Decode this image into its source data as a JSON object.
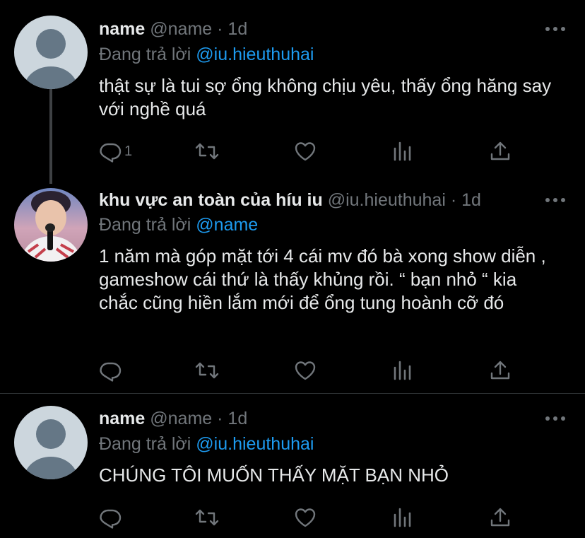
{
  "colors": {
    "background": "#000000",
    "text_primary": "#e7e9ea",
    "text_secondary": "#71767b",
    "link": "#1d9bf0",
    "divider": "#2f3336"
  },
  "tweets": [
    {
      "display_name": "name",
      "handle": "@name",
      "separator": "·",
      "time": "1d",
      "replying_prefix": "Đang trả lời",
      "replying_to": "@iu.hieuthuhai",
      "text": "thật sự là tui sợ ổng không chịu yêu, thấy ổng hăng say với nghề quá",
      "reply_count": "1",
      "avatar": "default-avatar"
    },
    {
      "display_name": "khu vực an toàn của híu iu",
      "handle": "@iu.hieuthuhai",
      "separator": "·",
      "time": "1d",
      "replying_prefix": "Đang trả lời",
      "replying_to": "@name",
      "text": "1 năm mà góp mặt tới 4 cái mv đó bà xong show diễn , gameshow cái thứ là thấy khủng rồi. “ bạn nhỏ “ kia chắc cũng hiền lắm mới để ổng tung hoành cỡ đó",
      "reply_count": "",
      "avatar": "photo-avatar"
    },
    {
      "display_name": "name",
      "handle": "@name",
      "separator": "·",
      "time": "1d",
      "replying_prefix": "Đang trả lời",
      "replying_to": "@iu.hieuthuhai",
      "text": "CHÚNG TÔI MUỐN THẤY MẶT BẠN NHỎ",
      "reply_count": "",
      "avatar": "default-avatar"
    }
  ],
  "action_icons": [
    "reply-icon",
    "retweet-icon",
    "like-icon",
    "analytics-icon",
    "share-icon"
  ]
}
